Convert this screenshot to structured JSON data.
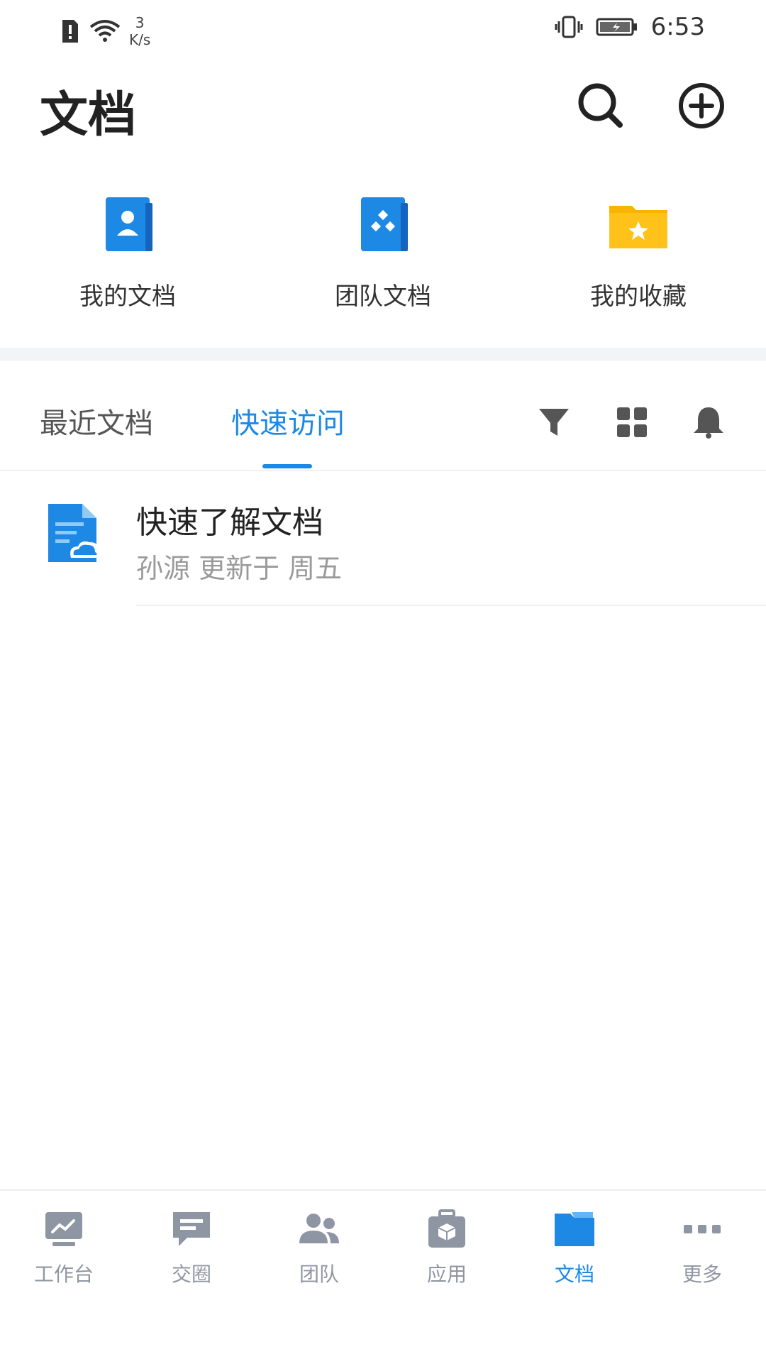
{
  "status_bar": {
    "speed_value": "3",
    "speed_unit": "K/s",
    "time": "6:53"
  },
  "header": {
    "title": "文档"
  },
  "quick_access": [
    {
      "label": "我的文档",
      "icon": "my-docs-icon"
    },
    {
      "label": "团队文档",
      "icon": "team-docs-icon"
    },
    {
      "label": "我的收藏",
      "icon": "favorites-folder-icon"
    }
  ],
  "tabs": {
    "recent": "最近文档",
    "quick": "快速访问"
  },
  "list": [
    {
      "title": "快速了解文档",
      "subtitle": "孙源 更新于 周五"
    }
  ],
  "bottom_nav": [
    {
      "label": "工作台"
    },
    {
      "label": "交圈"
    },
    {
      "label": "团队"
    },
    {
      "label": "应用"
    },
    {
      "label": "文档"
    },
    {
      "label": "更多"
    }
  ],
  "colors": {
    "accent": "#1e88e5",
    "folder_yellow": "#f7b500"
  }
}
